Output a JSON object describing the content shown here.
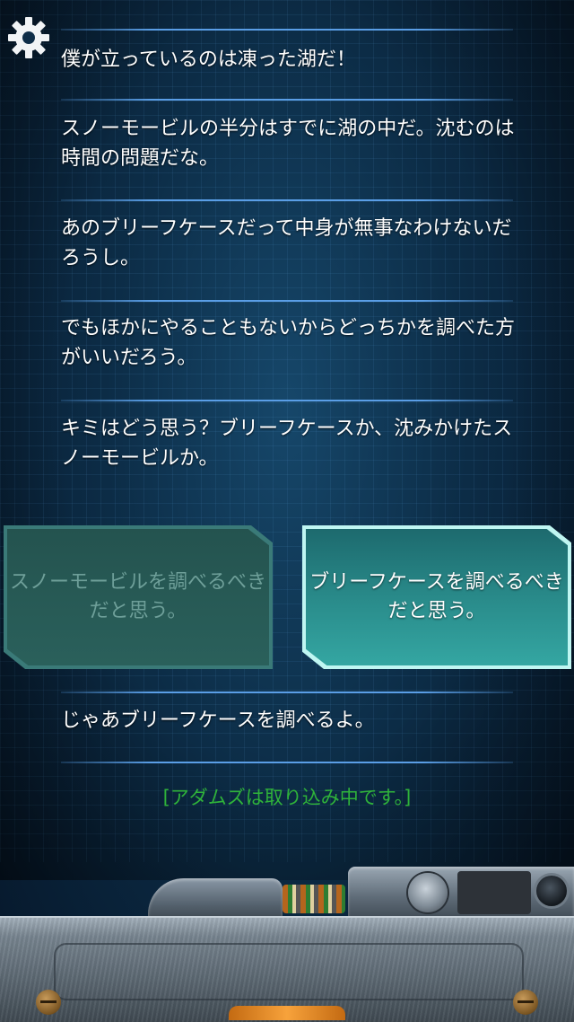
{
  "messages": [
    "僕が立っているのは凍った湖だ！",
    "スノーモービルの半分はすでに湖の中だ。沈むのは時間の問題だな。",
    "あのブリーフケースだって中身が無事なわけないだろうし。",
    "でもほかにやることもないからどっちかを調べた方がいいだろう。",
    "キミはどう思う？ブリーフケースか、沈みかけたスノーモービルか。"
  ],
  "choices": {
    "left": "スノーモービルを調べるべきだと思う。",
    "right": "ブリーフケースを調べるべきだと思う。"
  },
  "reply": "じゃあブリーフケースを調べるよ。",
  "status": "[アダムズは取り込み中です。]",
  "icons": {
    "settings": "gear-icon"
  },
  "colors": {
    "status_text": "#2fb33a",
    "selected_choice": "#2a8d8c"
  }
}
